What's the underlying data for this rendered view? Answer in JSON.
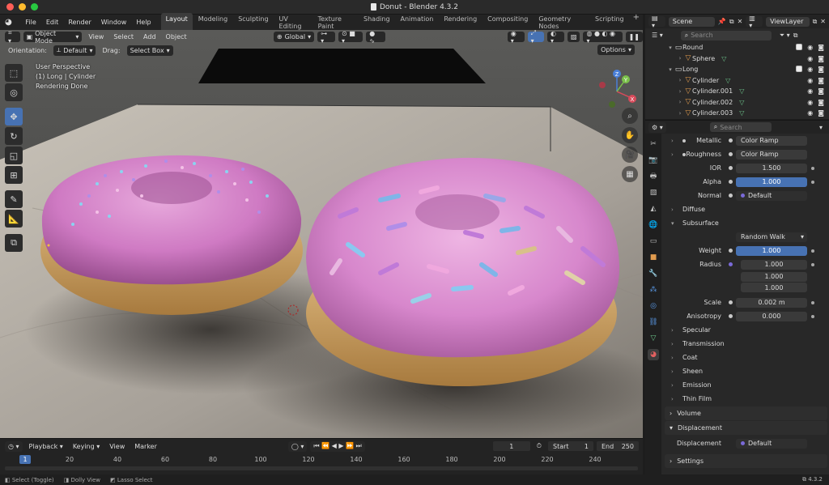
{
  "window": {
    "title": "Donut - Blender 4.3.2"
  },
  "menu": {
    "items": [
      "File",
      "Edit",
      "Render",
      "Window",
      "Help"
    ]
  },
  "workspaces": [
    "Layout",
    "Modeling",
    "Sculpting",
    "UV Editing",
    "Texture Paint",
    "Shading",
    "Animation",
    "Rendering",
    "Compositing",
    "Geometry Nodes",
    "Scripting"
  ],
  "viewport": {
    "mode": "Object Mode",
    "menus": [
      "View",
      "Select",
      "Add",
      "Object"
    ],
    "transform_space": "Global",
    "orientation_label": "Orientation:",
    "orientation_value": "Default",
    "drag_label": "Drag:",
    "drag_value": "Select Box",
    "options_label": "Options",
    "info_line1": "User Perspective",
    "info_line2": "(1) Long | Cylinder",
    "info_line3": "Rendering Done",
    "gizmo": {
      "x": "X",
      "y": "Y",
      "z": "Z"
    }
  },
  "timeline": {
    "menus": [
      "Playback",
      "Keying",
      "View",
      "Marker"
    ],
    "current_frame": "1",
    "start_label": "Start",
    "start_value": "1",
    "end_label": "End",
    "end_value": "250",
    "ruler": [
      "20",
      "40",
      "60",
      "80",
      "100",
      "120",
      "140",
      "160",
      "180",
      "200",
      "220",
      "240"
    ],
    "cursor_frame": "1"
  },
  "statusbar": {
    "items": [
      "Select (Toggle)",
      "Dolly View",
      "Lasso Select"
    ],
    "version": "4.3.2"
  },
  "outliner": {
    "scene": "Scene",
    "view_layer": "ViewLayer",
    "search_placeholder": "Search",
    "rows": [
      {
        "label": "Round",
        "depth": 0,
        "type": "collection"
      },
      {
        "label": "Sphere",
        "depth": 1,
        "type": "object"
      },
      {
        "label": "Long",
        "depth": 0,
        "type": "collection"
      },
      {
        "label": "Cylinder",
        "depth": 1,
        "type": "object"
      },
      {
        "label": "Cylinder.001",
        "depth": 1,
        "type": "object"
      },
      {
        "label": "Cylinder.002",
        "depth": 1,
        "type": "object"
      },
      {
        "label": "Cylinder.003",
        "depth": 1,
        "type": "object"
      }
    ]
  },
  "properties": {
    "search_placeholder": "Search",
    "metallic_label": "Metallic",
    "metallic_value": "Color Ramp",
    "roughness_label": "Roughness",
    "roughness_value": "Color Ramp",
    "ior_label": "IOR",
    "ior_value": "1.500",
    "alpha_label": "Alpha",
    "alpha_value": "1.000",
    "normal_label": "Normal",
    "normal_value": "Default",
    "diffuse_label": "Diffuse",
    "subsurface_label": "Subsurface",
    "subsurface_method": "Random Walk",
    "weight_label": "Weight",
    "weight_value": "1.000",
    "radius_label": "Radius",
    "radius_x": "1.000",
    "radius_y": "1.000",
    "radius_z": "1.000",
    "scale_label": "Scale",
    "scale_value": "0.002 m",
    "anisotropy_label": "Anisotropy",
    "anisotropy_value": "0.000",
    "specular_label": "Specular",
    "transmission_label": "Transmission",
    "coat_label": "Coat",
    "sheen_label": "Sheen",
    "emission_label": "Emission",
    "thin_film_label": "Thin Film",
    "volume_label": "Volume",
    "displacement_label": "Displacement",
    "displacement_row_label": "Displacement",
    "displacement_value": "Default",
    "settings_label": "Settings"
  }
}
